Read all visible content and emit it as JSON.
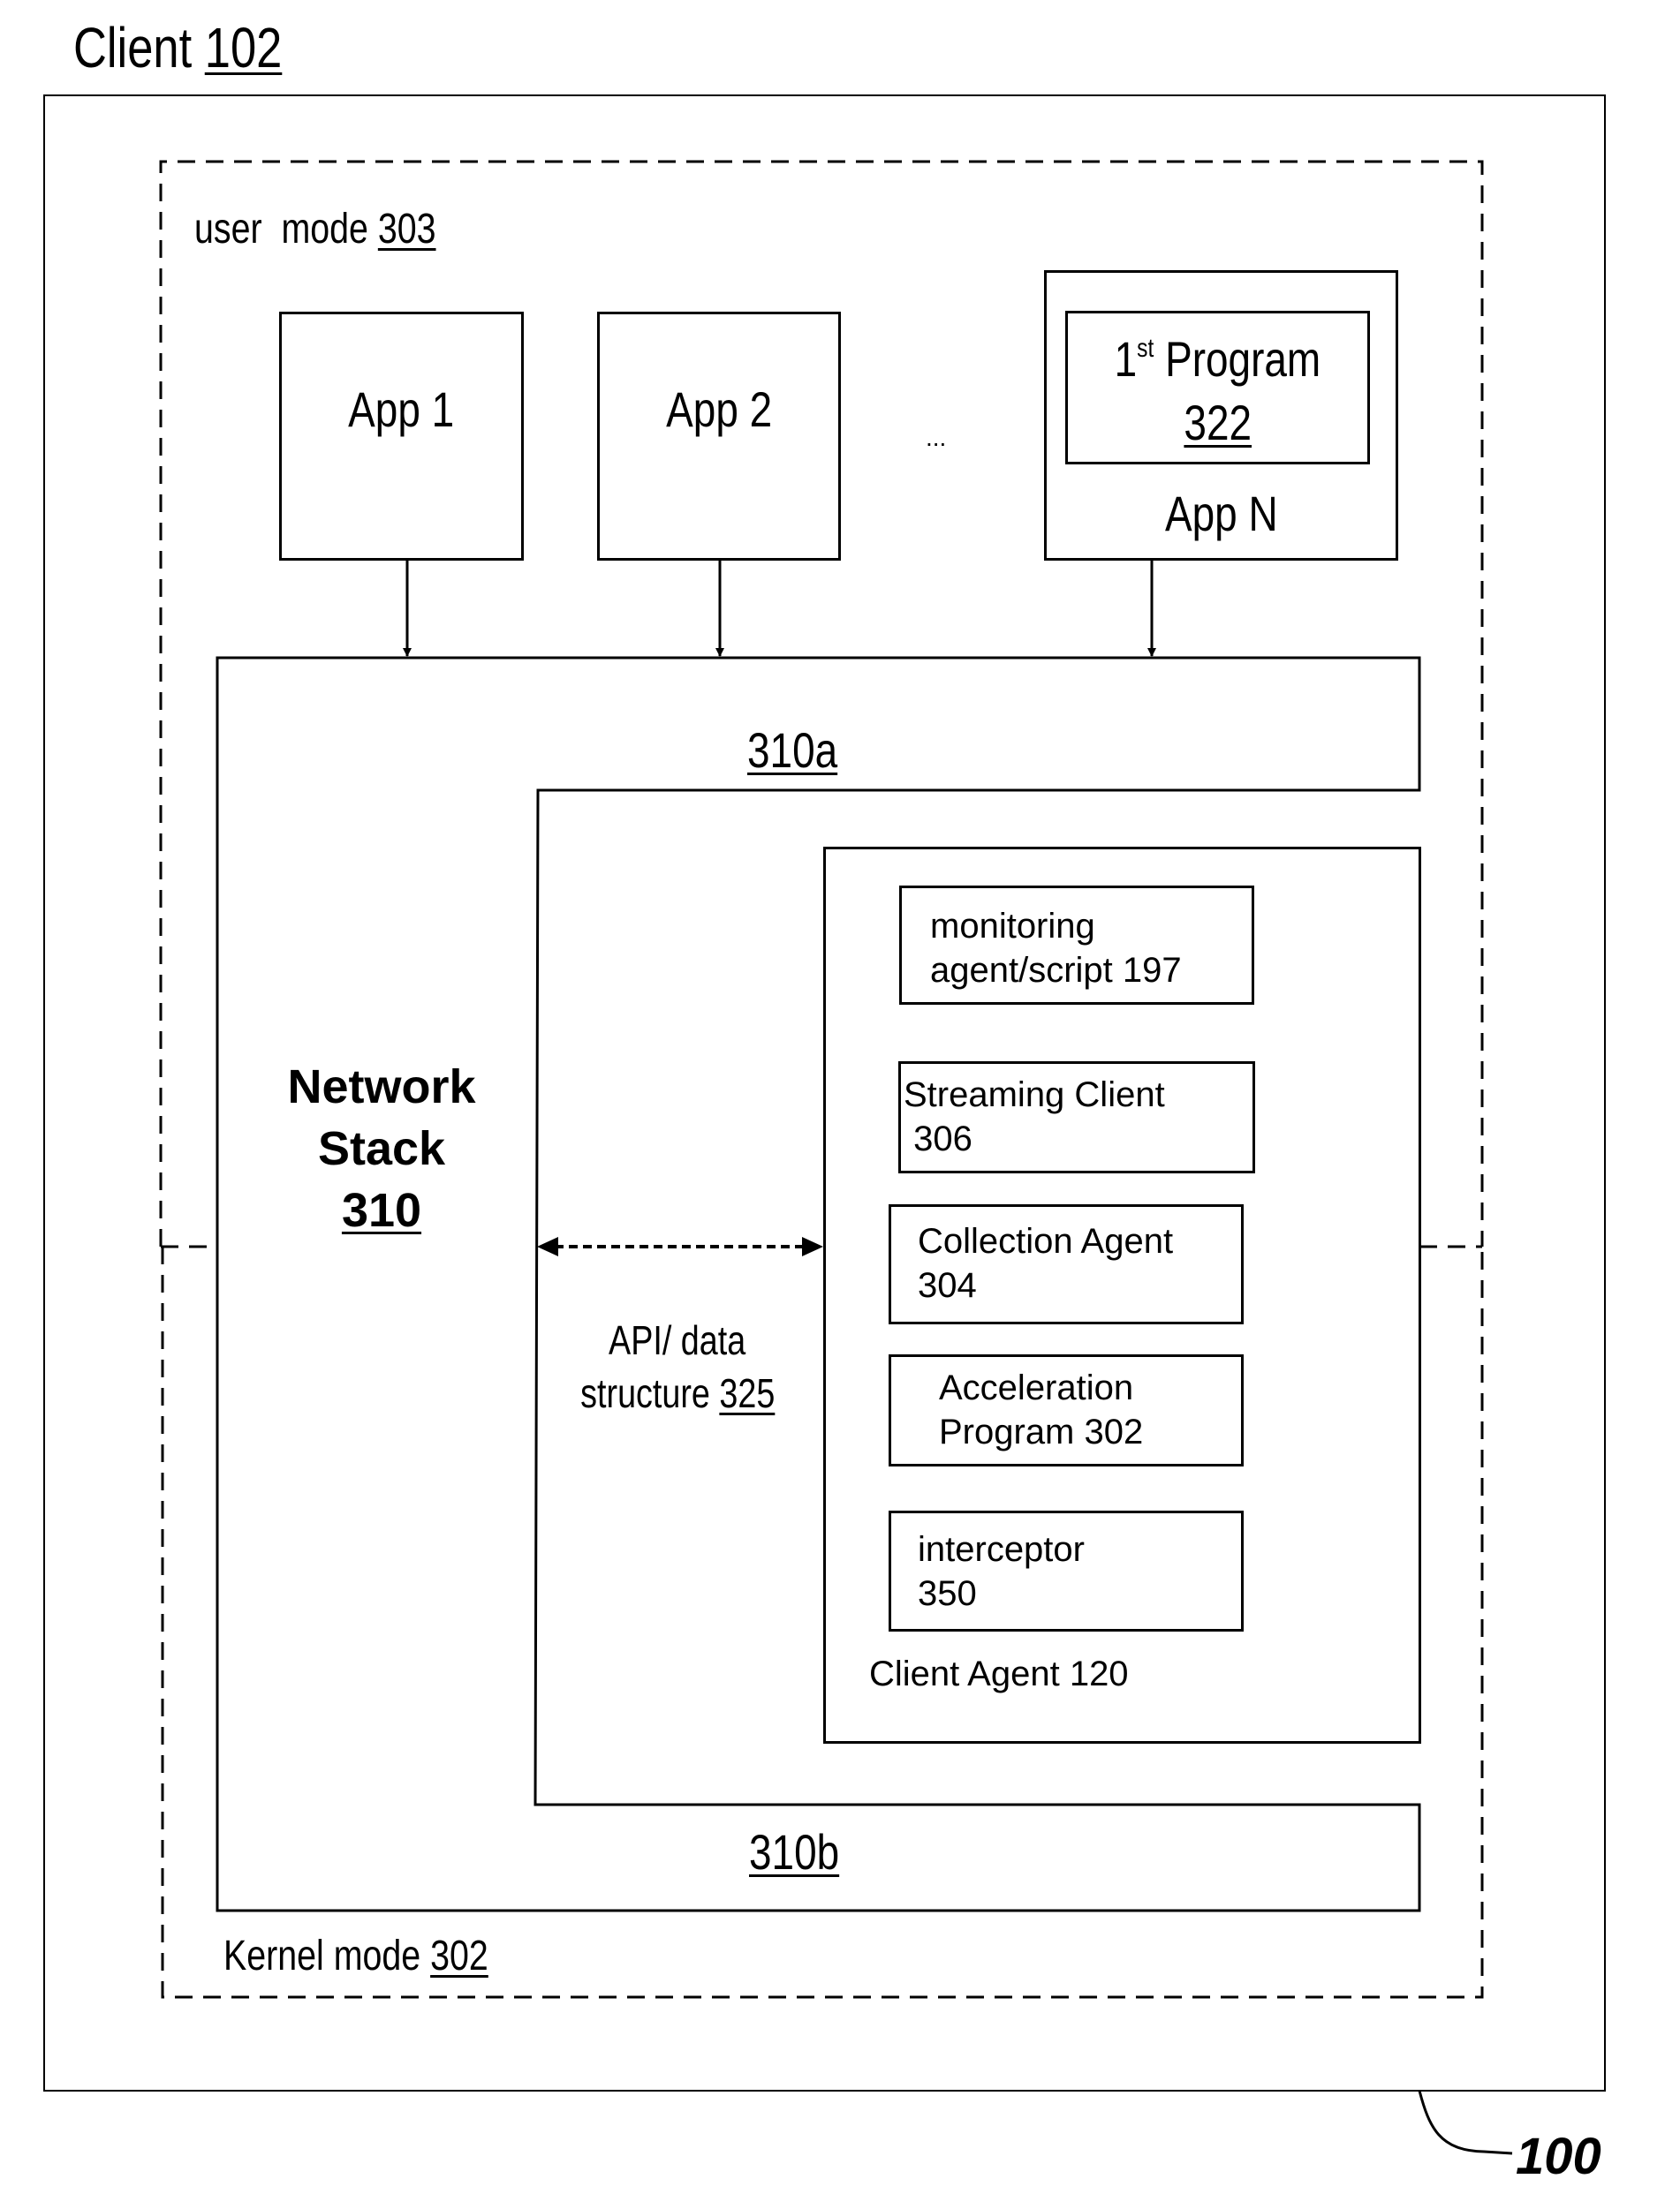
{
  "figure": {
    "title": {
      "text": "Client",
      "ref": "102"
    },
    "reference_numeral": "100"
  },
  "user_mode": {
    "text": "user  mode",
    "ref": "303"
  },
  "kernel_mode": {
    "text": "Kernel mode",
    "ref": "302"
  },
  "apps": [
    {
      "label": "App 1"
    },
    {
      "label": "App 2"
    },
    {
      "label": "App N",
      "program": {
        "ordinal": "1",
        "ordinal_suffix": "st",
        "name": "Program",
        "ref": "322"
      }
    }
  ],
  "ellipsis": "...",
  "network_stack": {
    "title_line1": "Network",
    "title_line2": "Stack",
    "ref": "310",
    "upper_ref": "310a",
    "lower_ref": "310b"
  },
  "api": {
    "line1": "API/ data",
    "line2_text": "structure",
    "ref": "325"
  },
  "client_agent": {
    "label": "Client Agent 120",
    "components": [
      {
        "line1": "monitoring",
        "line2": "agent/script 197"
      },
      {
        "line1": "Streaming Client",
        "line2": " 306"
      },
      {
        "line1": "Collection Agent",
        "line2": "304"
      },
      {
        "line1": "Acceleration",
        "line2": "Program 302"
      },
      {
        "line1": "interceptor",
        "line2": "350"
      }
    ]
  }
}
